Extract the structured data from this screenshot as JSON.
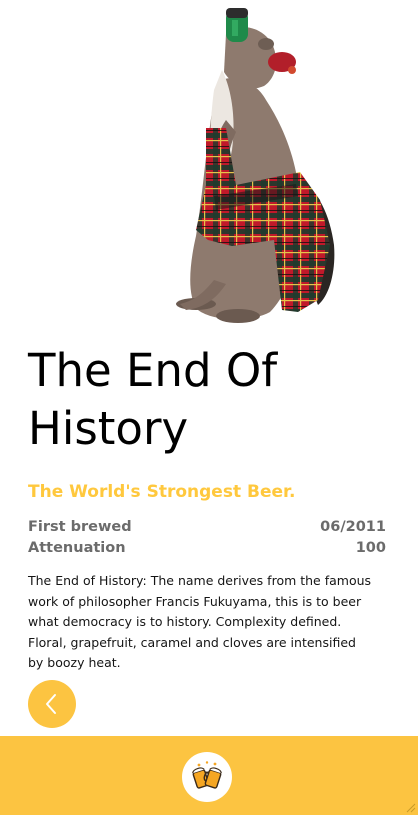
{
  "beer": {
    "name": "The End Of History",
    "tagline": "The World's Strongest Beer.",
    "description": "The End of History: The name derives from the famous work of philosopher Francis Fukuyama, this is to beer what democracy is to history. Complexity defined. Floral, grapefruit, caramel and cloves are intensified by boozy heat."
  },
  "stats": [
    {
      "label": "First brewed",
      "value": "06/2011"
    },
    {
      "label": "Attenuation",
      "value": "100"
    }
  ],
  "icons": {
    "back": "chevron-left-icon",
    "footer_logo": "beer-mugs-cheers-icon"
  },
  "colors": {
    "accent": "#fcc441",
    "tagline": "#ffc83d",
    "stat_text": "#6b6b6b"
  }
}
